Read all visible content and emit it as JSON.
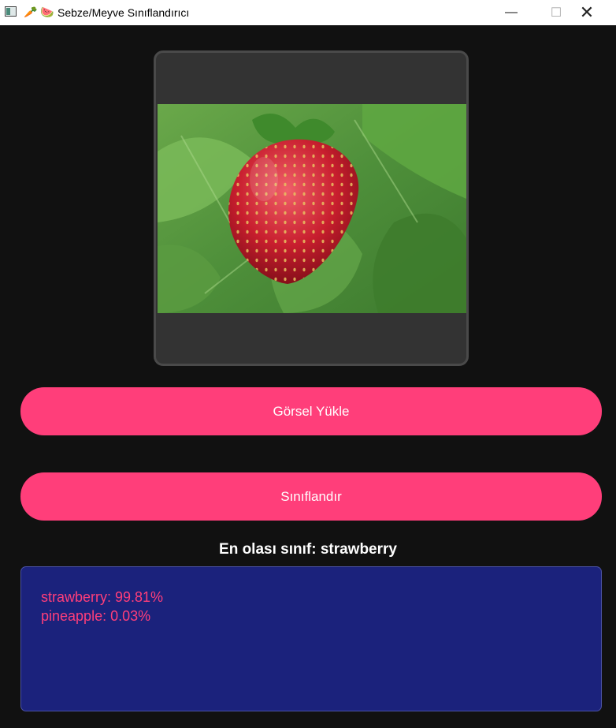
{
  "window": {
    "title": "Sebze/Meyve Sınıflandırıcı",
    "title_emoji_1": "🥕",
    "title_emoji_2": "🍉",
    "minimize_glyph": "—",
    "maximize_glyph": "☐",
    "close_glyph": "✕"
  },
  "buttons": {
    "upload_label": "Görsel Yükle",
    "classify_label": "Sınıflandır"
  },
  "result": {
    "top_class_text": "En olası sınıf: strawberry",
    "predictions": [
      "strawberry: 99.81%",
      "pineapple: 0.03%"
    ]
  },
  "colors": {
    "background": "#111111",
    "accent": "#ff3e7a",
    "results_panel": "#1b227c",
    "preview_frame": "#333333"
  }
}
